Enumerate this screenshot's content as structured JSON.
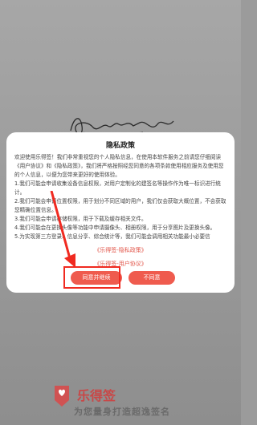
{
  "dialog": {
    "title": "隐私政策",
    "paragraphs": [
      "欢迎使用乐得签！我们非常重视您的个人隐私信息，在使用本软件服务之前请您仔细阅读《用户协议》和《隐私政策》，我们将严格按照经您同意的各项条款使用相应服务及使用您的个人信息，以便为您带来更好的使用体验。",
      "1.我们可能会申请收集设备信息权限，对用户定制化的建签名等操作作为唯一标识进行统计。",
      "2.我们可能会申请位置权限，用于划分不同区域的用户，我们仅会获取大概位置，不会获取您精确位置信息。",
      "3.我们可能会申请存储权限，用于下载及缓存相关文件。",
      "4.我们可能会在更换头像等功能中申请摄像头、相册权限，用于分享图片及更换头像。",
      "5.为实现第三方登录、信息分享、综合统计等，我们可能会调用相关功能最小必要信"
    ],
    "link_privacy": "《乐得签-隐私政策》",
    "link_user": "《乐得签-用户协议》",
    "agree_label": "同意并继续",
    "disagree_label": "不同意"
  },
  "brand": {
    "name": "乐得签",
    "slogan": "为您量身打造超逸签名"
  },
  "colors": {
    "accent": "#ef5b4e",
    "highlight": "#f02a20",
    "brand": "#c94747"
  }
}
